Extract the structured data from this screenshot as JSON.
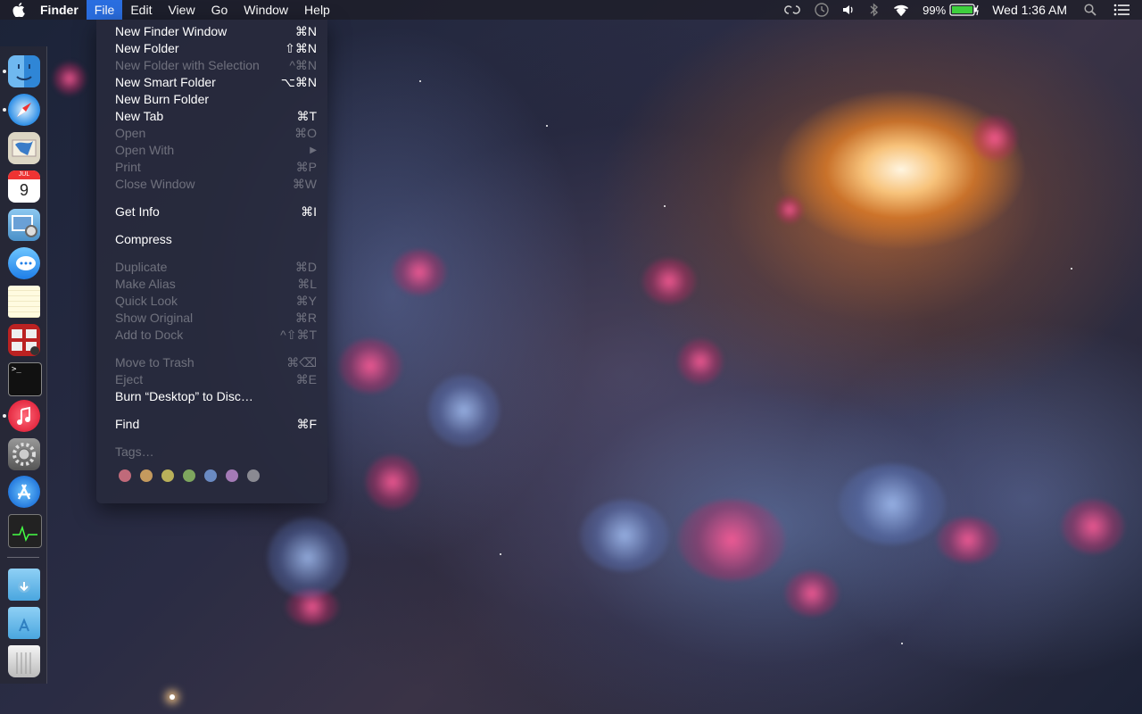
{
  "menubar": {
    "app_name": "Finder",
    "menus": [
      "File",
      "Edit",
      "View",
      "Go",
      "Window",
      "Help"
    ],
    "active_menu": "File",
    "status": {
      "battery_percent": "99%",
      "clock": "Wed 1:36 AM"
    }
  },
  "file_menu": {
    "items": [
      {
        "label": "New Finder Window",
        "shortcut": "⌘N",
        "enabled": true
      },
      {
        "label": "New Folder",
        "shortcut": "⇧⌘N",
        "enabled": true
      },
      {
        "label": "New Folder with Selection",
        "shortcut": "^⌘N",
        "enabled": false
      },
      {
        "label": "New Smart Folder",
        "shortcut": "⌥⌘N",
        "enabled": true
      },
      {
        "label": "New Burn Folder",
        "shortcut": "",
        "enabled": true
      },
      {
        "label": "New Tab",
        "shortcut": "⌘T",
        "enabled": true
      },
      {
        "label": "Open",
        "shortcut": "⌘O",
        "enabled": false
      },
      {
        "label": "Open With",
        "shortcut": "▶",
        "enabled": false
      },
      {
        "label": "Print",
        "shortcut": "⌘P",
        "enabled": false
      },
      {
        "label": "Close Window",
        "shortcut": "⌘W",
        "enabled": false
      },
      {
        "label": "Get Info",
        "shortcut": "⌘I",
        "enabled": true
      },
      {
        "label": "Compress",
        "shortcut": "",
        "enabled": true
      },
      {
        "label": "Duplicate",
        "shortcut": "⌘D",
        "enabled": false
      },
      {
        "label": "Make Alias",
        "shortcut": "⌘L",
        "enabled": false
      },
      {
        "label": "Quick Look",
        "shortcut": "⌘Y",
        "enabled": false
      },
      {
        "label": "Show Original",
        "shortcut": "⌘R",
        "enabled": false
      },
      {
        "label": "Add to Dock",
        "shortcut": "^⇧⌘T",
        "enabled": false
      },
      {
        "label": "Move to Trash",
        "shortcut": "⌘⌫",
        "enabled": false
      },
      {
        "label": "Eject",
        "shortcut": "⌘E",
        "enabled": false
      },
      {
        "label": "Burn “Desktop” to Disc…",
        "shortcut": "",
        "enabled": true
      },
      {
        "label": "Find",
        "shortcut": "⌘F",
        "enabled": true
      },
      {
        "label": "Tags…",
        "shortcut": "",
        "enabled": false
      }
    ],
    "tag_colors": [
      "#c06a7a",
      "#c49a5e",
      "#b9b05a",
      "#7ea65e",
      "#6a8ac2",
      "#a47ab6",
      "#8a8a92"
    ]
  },
  "dock": {
    "apps": [
      {
        "name": "finder-icon",
        "running": true
      },
      {
        "name": "safari-icon",
        "running": true
      },
      {
        "name": "mail-icon",
        "running": false
      },
      {
        "name": "calendar-icon",
        "running": false,
        "text": "9",
        "month": "JUL"
      },
      {
        "name": "preview-icon",
        "running": false
      },
      {
        "name": "messages-icon",
        "running": false
      },
      {
        "name": "notes-icon",
        "running": false
      },
      {
        "name": "photo-booth-icon",
        "running": false
      },
      {
        "name": "terminal-icon",
        "running": false,
        "text": ">_"
      },
      {
        "name": "itunes-icon",
        "running": true
      },
      {
        "name": "system-preferences-icon",
        "running": false
      },
      {
        "name": "app-store-icon",
        "running": false
      },
      {
        "name": "activity-monitor-icon",
        "running": false
      },
      {
        "name": "downloads-folder-icon",
        "running": false
      },
      {
        "name": "applications-folder-icon",
        "running": false
      },
      {
        "name": "trash-icon",
        "running": false
      }
    ]
  }
}
